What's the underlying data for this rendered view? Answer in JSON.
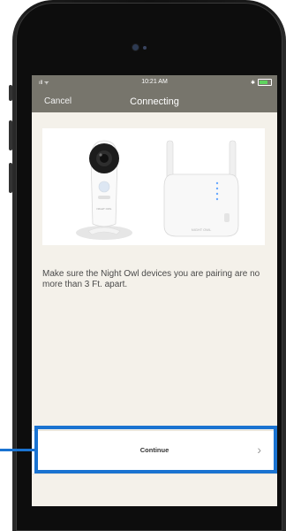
{
  "status_bar": {
    "signal": "ıll ᯤ",
    "time": "10:21 AM",
    "battery_icon": "battery-charging-icon"
  },
  "nav": {
    "cancel_label": "Cancel",
    "title": "Connecting"
  },
  "hero": {
    "devices": [
      "camera",
      "wifi-extender"
    ],
    "extender_brand": "NIGHT OWL"
  },
  "instruction": "Make sure the Night Owl devices you are pairing are no more than 3 Ft. apart.",
  "continue_button": {
    "label": "Continue",
    "chevron": "›"
  },
  "highlight_color": "#1a73d1"
}
